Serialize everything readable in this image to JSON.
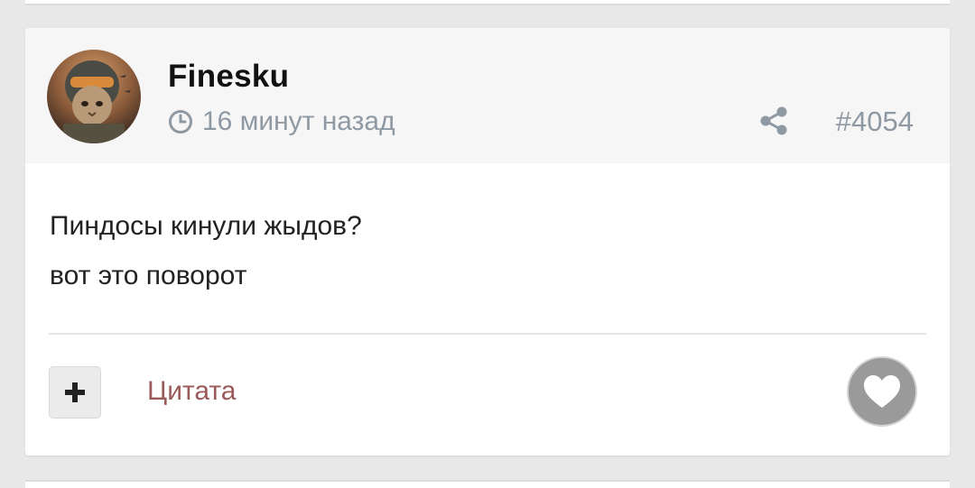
{
  "post": {
    "author": "Finesku",
    "time_ago": "16 минут назад",
    "post_number": "#4054",
    "body_lines": [
      "Пиндосы кинули жыдов?",
      "вот это поворот"
    ],
    "quote_label": "Цитата"
  },
  "icons": {
    "clock": "clock-icon",
    "share": "share-icon",
    "plus": "plus-icon",
    "heart": "heart-icon"
  },
  "colors": {
    "meta_text": "#8f99a3",
    "quote_link": "#9a5a5a",
    "like_button": "#9a9a9a",
    "header_bg": "#f6f6f6"
  }
}
